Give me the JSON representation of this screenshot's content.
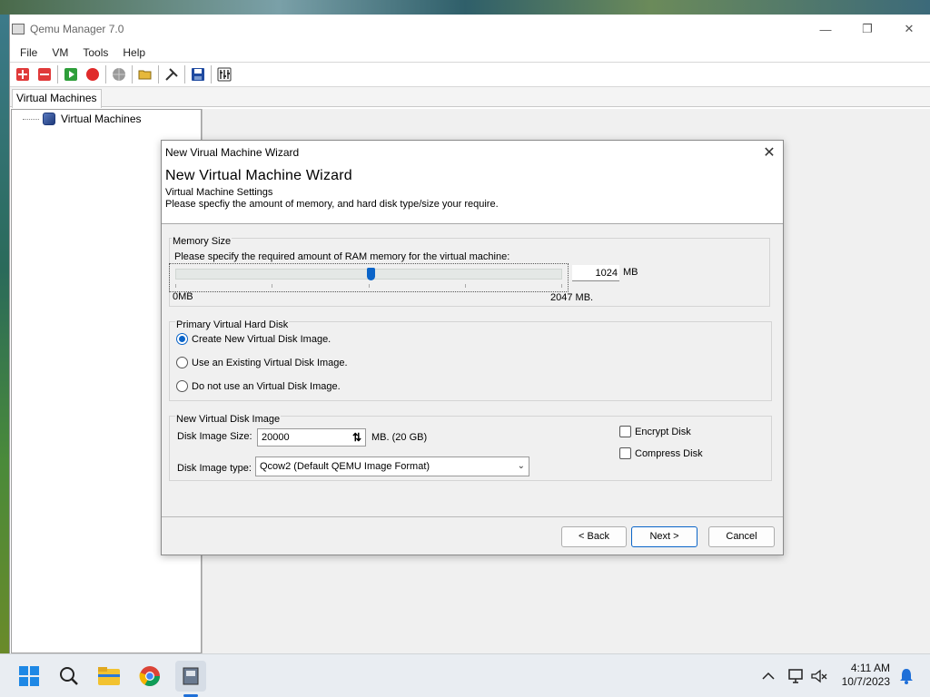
{
  "window": {
    "title": "Qemu Manager 7.0",
    "controls": {
      "minimize": "—",
      "restore": "❐",
      "close": "✕"
    }
  },
  "menu": [
    "File",
    "VM",
    "Tools",
    "Help"
  ],
  "toolbar": {
    "buttons": [
      "add-vm-icon",
      "remove-vm-icon",
      "play-icon",
      "stop-icon",
      "globe-icon",
      "folder-open-icon",
      "tools-icon",
      "save-icon",
      "settings-icon"
    ]
  },
  "tabs": {
    "active": "Virtual Machines"
  },
  "tree": {
    "root": "Virtual Machines"
  },
  "dialog": {
    "title": "New Virual Machine Wizard",
    "heading": "New Virtual Machine Wizard",
    "subtitle": "Virtual Machine Settings",
    "description": "Please specfiy the amount of memory, and hard disk type/size your require.",
    "close": "✕",
    "memory": {
      "legend": "Memory Size",
      "prompt": "Please specify the required amount of RAM memory for the virtual machine:",
      "value": "1024",
      "unit": "MB",
      "min_label": "0MB",
      "max_label": "2047 MB.",
      "slider_fraction": 0.5
    },
    "hard_disk": {
      "legend": "Primary Virtual Hard Disk",
      "options": [
        {
          "label": "Create New Virtual Disk Image.",
          "selected": true
        },
        {
          "label": "Use an  Existing Virtual Disk Image.",
          "selected": false
        },
        {
          "label": "Do not use an Virtual Disk Image.",
          "selected": false
        }
      ]
    },
    "new_disk": {
      "legend": "New Virtual Disk Image",
      "size_label": "Disk Image Size:",
      "size_value": "20000",
      "size_unit": "MB. (20 GB)",
      "type_label": "Disk Image type:",
      "type_value": "Qcow2  (Default QEMU Image Format)",
      "encrypt_label": "Encrypt Disk",
      "compress_label": "Compress Disk"
    },
    "buttons": {
      "back": "< Back",
      "next": "Next >",
      "cancel": "Cancel"
    }
  },
  "taskbar": {
    "time": "4:11 AM",
    "date": "10/7/2023",
    "tray_chevron": "^"
  }
}
